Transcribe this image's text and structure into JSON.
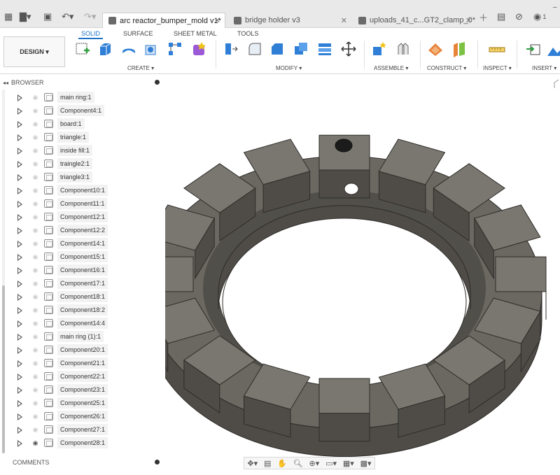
{
  "tabs": [
    {
      "title": "arc reactor_bumper_mold v1*",
      "active": true
    },
    {
      "title": "bridge holder v3",
      "active": false
    },
    {
      "title": "uploads_41_c...GT2_clamp_0*",
      "active": false
    }
  ],
  "titlebar": {
    "notification_count": "1"
  },
  "workspace_tabs": [
    "SOLID",
    "SURFACE",
    "SHEET METAL",
    "TOOLS"
  ],
  "design_button": "DESIGN ▾",
  "tool_groups": [
    {
      "label": "CREATE ▾"
    },
    {
      "label": "MODIFY ▾"
    },
    {
      "label": "ASSEMBLE ▾"
    },
    {
      "label": "CONSTRUCT ▾"
    },
    {
      "label": "INSPECT ▾"
    },
    {
      "label": "INSERT ▾"
    }
  ],
  "browser": {
    "title": "BROWSER",
    "items": [
      {
        "label": "main ring:1",
        "visible": false
      },
      {
        "label": "Component4:1",
        "visible": false
      },
      {
        "label": "board:1",
        "visible": false
      },
      {
        "label": "triangle:1",
        "visible": false
      },
      {
        "label": "inside fill:1",
        "visible": false
      },
      {
        "label": "traingle2:1",
        "visible": false
      },
      {
        "label": "triangle3:1",
        "visible": false
      },
      {
        "label": "Component10:1",
        "visible": false
      },
      {
        "label": "Component11:1",
        "visible": false
      },
      {
        "label": "Component12:1",
        "visible": false
      },
      {
        "label": "Component12:2",
        "visible": false
      },
      {
        "label": "Component14:1",
        "visible": false
      },
      {
        "label": "Component15:1",
        "visible": false
      },
      {
        "label": "Component16:1",
        "visible": false
      },
      {
        "label": "Component17:1",
        "visible": false
      },
      {
        "label": "Component18:1",
        "visible": false
      },
      {
        "label": "Component18:2",
        "visible": false
      },
      {
        "label": "Component14:4",
        "visible": false
      },
      {
        "label": "main ring (1):1",
        "visible": false
      },
      {
        "label": "Component20:1",
        "visible": false
      },
      {
        "label": "Component21:1",
        "visible": false
      },
      {
        "label": "Component22:1",
        "visible": false
      },
      {
        "label": "Component23:1",
        "visible": false
      },
      {
        "label": "Component25:1",
        "visible": false
      },
      {
        "label": "Component26:1",
        "visible": false
      },
      {
        "label": "Component27:1",
        "visible": false
      },
      {
        "label": "Component28:1",
        "visible": true
      }
    ]
  },
  "comments": {
    "title": "COMMENTS"
  },
  "colors": {
    "accent": "#1e73c8",
    "model": "#6b6862",
    "model_dark": "#4f4c47",
    "model_light": "#7a7770"
  }
}
